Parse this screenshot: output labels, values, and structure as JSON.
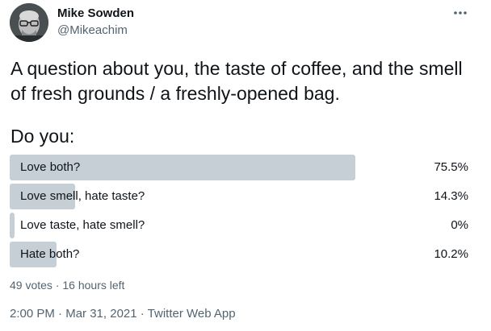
{
  "author": {
    "name": "Mike Sowden",
    "handle": "@Mikeachim"
  },
  "tweet": {
    "text": "A question about you, the taste of coffee, and the smell of fresh grounds / a freshly-opened bag."
  },
  "poll": {
    "question": "Do you:",
    "options": [
      {
        "label": "Love both?",
        "percent_text": "75.5%",
        "percent": 75.5
      },
      {
        "label": "Love smell, hate taste?",
        "percent_text": "14.3%",
        "percent": 14.3
      },
      {
        "label": "Love taste, hate smell?",
        "percent_text": "0%",
        "percent": 0
      },
      {
        "label": "Hate both?",
        "percent_text": "10.2%",
        "percent": 10.2
      }
    ],
    "votes": "49 votes",
    "separator": " · ",
    "time_left": "16 hours left"
  },
  "meta": {
    "time": "2:00 PM",
    "separator": " · ",
    "date": "Mar 31, 2021",
    "source": "Twitter Web App"
  },
  "colors": {
    "bar": "#c5cfd5",
    "secondary_text": "#536471",
    "primary_text": "#0f1419"
  },
  "icons": {
    "more": "more-horizontal-icon"
  }
}
